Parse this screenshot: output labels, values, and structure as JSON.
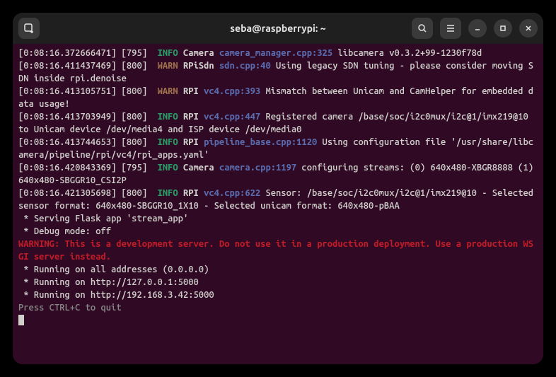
{
  "title": "seba@raspberrypi: ~",
  "log": [
    {
      "ts": "[0:08:16.372666471] [795] ",
      "level": "INFO",
      "comp": "Camera",
      "loc": "camera_manager.cpp:325",
      "msg": " libcamera v0.3.2+99-1230f78d"
    },
    {
      "ts": "[0:08:16.411437469] [800] ",
      "level": "WARN",
      "comp": "RPiSdn",
      "loc": "sdn.cpp:40",
      "msg": " Using legacy SDN tuning - please consider moving SDN inside rpi.denoise"
    },
    {
      "ts": "[0:08:16.413105751] [800] ",
      "level": "WARN",
      "comp": "RPI",
      "loc": "vc4.cpp:393",
      "msg": " Mismatch between Unicam and CamHelper for embedded data usage!"
    },
    {
      "ts": "[0:08:16.413703949] [800] ",
      "level": "INFO",
      "comp": "RPI",
      "loc": "vc4.cpp:447",
      "msg": " Registered camera /base/soc/i2c0mux/i2c@1/imx219@10 to Unicam device /dev/media4 and ISP device /dev/media0"
    },
    {
      "ts": "[0:08:16.413744653] [800] ",
      "level": "INFO",
      "comp": "RPI",
      "loc": "pipeline_base.cpp:1120",
      "msg": " Using configuration file '/usr/share/libcamera/pipeline/rpi/vc4/rpi_apps.yaml'"
    },
    {
      "ts": "[0:08:16.420843369] [795] ",
      "level": "INFO",
      "comp": "Camera",
      "loc": "camera.cpp:1197",
      "msg": " configuring streams: (0) 640x480-XBGR8888 (1) 640x480-SBGGR10_CSI2P"
    },
    {
      "ts": "[0:08:16.421305698] [800] ",
      "level": "INFO",
      "comp": "RPI",
      "loc": "vc4.cpp:622",
      "msg": " Sensor: /base/soc/i2c0mux/i2c@1/imx219@10 - Selected sensor format: 640x480-SBGGR10_1X10 - Selected unicam format: 640x480-pBAA"
    }
  ],
  "flask": {
    "serving": " * Serving Flask app 'stream_app'",
    "debug": " * Debug mode: off",
    "warning": "WARNING: This is a development server. Do not use it in a production deployment. Use a production WSGI server instead.",
    "run_all": " * Running on all addresses (0.0.0.0)",
    "run_local": " * Running on http://127.0.0.1:5000",
    "run_ip": " * Running on http://192.168.3.42:5000",
    "quit": "Press CTRL+C to quit"
  }
}
